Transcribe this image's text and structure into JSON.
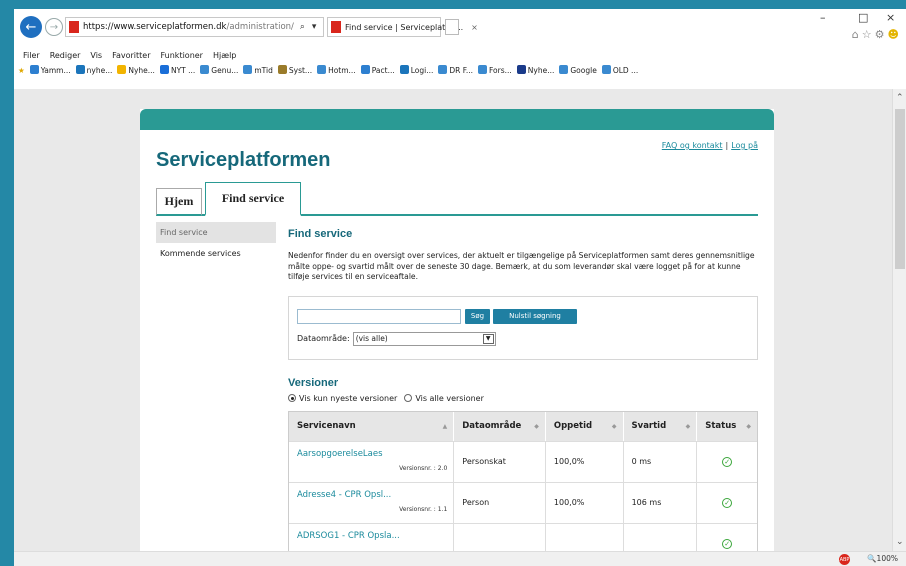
{
  "browser": {
    "url_host": "https://www.serviceplatformen.dk",
    "url_path": "/administration/",
    "url_controls": "⌕ ▾ 🔒 ↻",
    "tab_title": "Find service | Serviceplatfor...",
    "tab_close": "×",
    "menu": [
      "Filer",
      "Rediger",
      "Vis",
      "Favoritter",
      "Funktioner",
      "Hjælp"
    ],
    "bookmarks": [
      "Yamm...",
      "nyhe...",
      "Nyhe...",
      "NYT ...",
      "Genu...",
      "mTid",
      "Syst...",
      "Hotm...",
      "Pact...",
      "Logi...",
      "DR F...",
      "Fors...",
      "Nyhe...",
      "Google",
      "OLD ..."
    ],
    "zoom": "🔍100%",
    "abp": "ABP",
    "win_min": "–",
    "win_max": "□",
    "win_close": "×"
  },
  "site": {
    "title": "Serviceplatformen",
    "links": {
      "faq": "FAQ og kontakt",
      "sep": "|",
      "login": "Log på"
    },
    "tabs": {
      "home": "Hjem",
      "find": "Find service"
    },
    "sidebar": [
      "Find service",
      "Kommende services"
    ],
    "heading": "Find service",
    "intro": "Nedenfor finder du en oversigt over services, der aktuelt er tilgængelige på Serviceplatformen samt deres gennemsnitlige målte oppe- og svartid målt over de seneste 30 dage. Bemærk, at du som leverandør skal være logget på for at kunne tilføje services til en serviceaftale.",
    "search": {
      "value": "",
      "search_button": "Søg",
      "reset_button": "Nulstil søgning",
      "area_label": "Dataområde:",
      "area_selected": "(vis alle)"
    },
    "versions": {
      "heading": "Versioner",
      "opt_latest": "Vis kun nyeste versioner",
      "opt_all": "Vis alle versioner"
    },
    "table": {
      "headers": [
        "Servicenavn",
        "Dataområde",
        "Oppetid",
        "Svartid",
        "Status"
      ],
      "rows": [
        {
          "name": "AarsopgoerelseLaes",
          "version": "Versionsnr. : 2.0",
          "area": "Personskat",
          "uptime": "100,0%",
          "response": "0 ms",
          "status": "ok"
        },
        {
          "name": "Adresse4 - CPR Opsl...",
          "version": "Versionsnr. : 1.1",
          "area": "Person",
          "uptime": "100,0%",
          "response": "106 ms",
          "status": "ok"
        },
        {
          "name": "ADRSOG1 - CPR Opsla...",
          "version": "",
          "area": "",
          "uptime": "",
          "response": "",
          "status": "ok"
        }
      ]
    }
  }
}
